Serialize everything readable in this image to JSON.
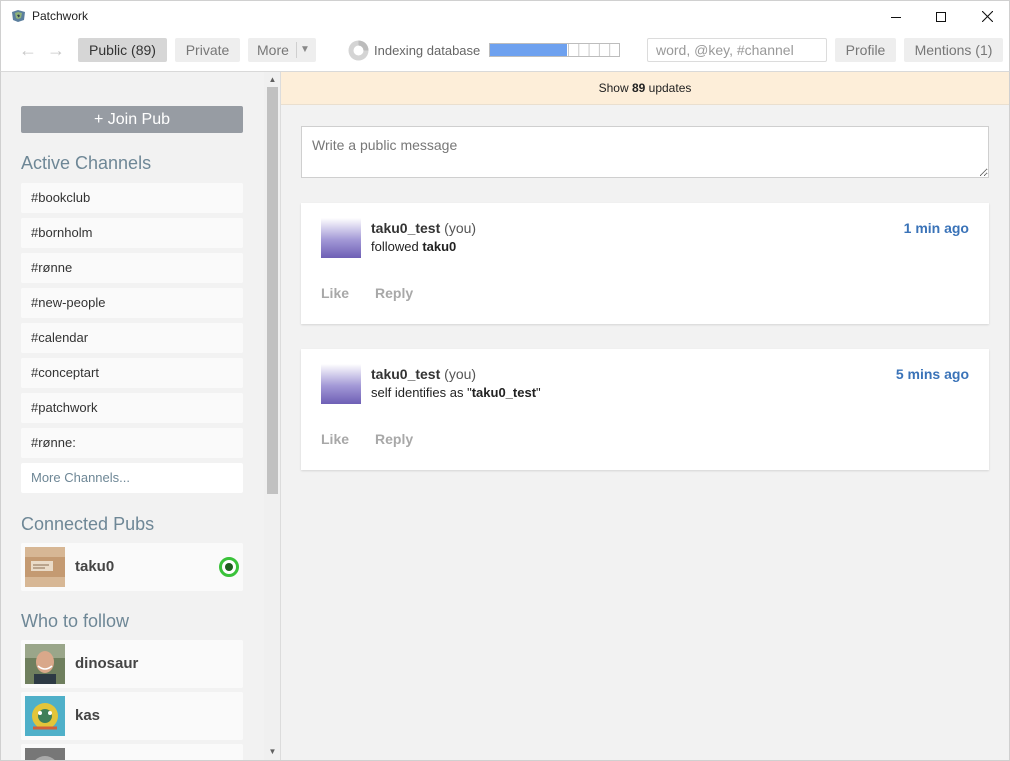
{
  "window": {
    "title": "Patchwork"
  },
  "toolbar": {
    "public_label": "Public (89)",
    "private_label": "Private",
    "more_label": "More",
    "indexing_label": "Indexing database",
    "indexing_progress": 0.6,
    "search_placeholder": "word, @key, #channel",
    "profile_label": "Profile",
    "mentions_label": "Mentions (1)"
  },
  "sidebar": {
    "join_label": "+ Join Pub",
    "channels_title": "Active Channels",
    "channels": [
      "#bookclub",
      "#bornholm",
      "#rønne",
      "#new-people",
      "#calendar",
      "#conceptart",
      "#patchwork",
      "#rønne:"
    ],
    "more_channels_label": "More Channels...",
    "pubs_title": "Connected Pubs",
    "pubs": [
      {
        "name": "taku0"
      }
    ],
    "follow_title": "Who to follow",
    "follow": [
      {
        "name": "dinosaur"
      },
      {
        "name": "kas"
      }
    ]
  },
  "main": {
    "updates": {
      "prefix": "Show ",
      "count": "89",
      "suffix": " updates"
    },
    "composer_placeholder": "Write a public message",
    "posts": [
      {
        "author": "taku0_test",
        "you": " (you)",
        "content_prefix": "followed ",
        "content_bold": "taku0",
        "content_suffix": "",
        "time": "1 min ago",
        "like": "Like",
        "reply": "Reply"
      },
      {
        "author": "taku0_test",
        "you": " (you)",
        "content_prefix": "self identifies as \"",
        "content_bold": "taku0_test",
        "content_suffix": "\"",
        "time": "5 mins ago",
        "like": "Like",
        "reply": "Reply"
      }
    ]
  },
  "colors": {
    "accent_link": "#3a73b8",
    "section_title": "#6e8796",
    "progress_fill": "#6ea1ef",
    "updates_bar": "#fdeed9",
    "online_status": "#3ac23a"
  }
}
